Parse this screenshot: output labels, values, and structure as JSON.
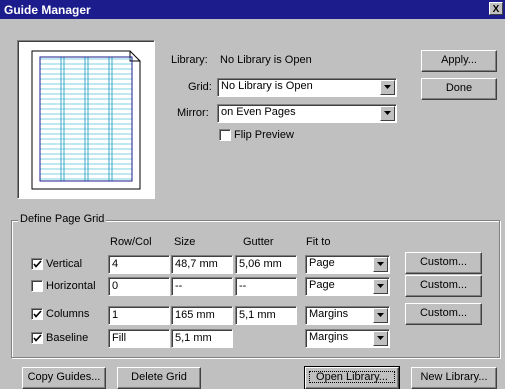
{
  "window": {
    "title": "Guide Manager",
    "close": "X"
  },
  "top": {
    "library_label": "Library:",
    "library_value": "No Library is Open",
    "grid_label": "Grid:",
    "grid_value": "No Library is Open",
    "mirror_label": "Mirror:",
    "mirror_value": "on Even Pages",
    "flip_preview_label": "Flip Preview",
    "flip_preview_checked": false,
    "apply_button": "Apply...",
    "done_button": "Done"
  },
  "define_grid": {
    "group_title": "Define Page Grid",
    "headers": {
      "rowcol": "Row/Col",
      "size": "Size",
      "gutter": "Gutter",
      "fit": "Fit to"
    },
    "rows": [
      {
        "label": "Vertical",
        "checked": true,
        "rowcol": "4",
        "size": "48,7 mm",
        "gutter": "5,06 mm",
        "fit": "Page",
        "custom": "Custom..."
      },
      {
        "label": "Horizontal",
        "checked": false,
        "rowcol": "0",
        "size": "--",
        "gutter": "--",
        "fit": "Page",
        "custom": "Custom..."
      },
      {
        "label": "Columns",
        "checked": true,
        "rowcol": "1",
        "size": "165 mm",
        "gutter": "5,1 mm",
        "fit": "Margins",
        "custom": "Custom..."
      },
      {
        "label": "Baseline",
        "checked": true,
        "rowcol": "Fill",
        "size": "5,1 mm",
        "gutter": "",
        "fit": "Margins",
        "custom": ""
      }
    ]
  },
  "bottom": {
    "copy_guides": "Copy Guides...",
    "delete_grid": "Delete Grid",
    "open_library": "Open Library...",
    "new_library": "New Library..."
  },
  "icons": {
    "checkbox_check": "check-mark-icon",
    "dropdown": "chevron-down-icon",
    "preview": "page-grid-preview"
  }
}
